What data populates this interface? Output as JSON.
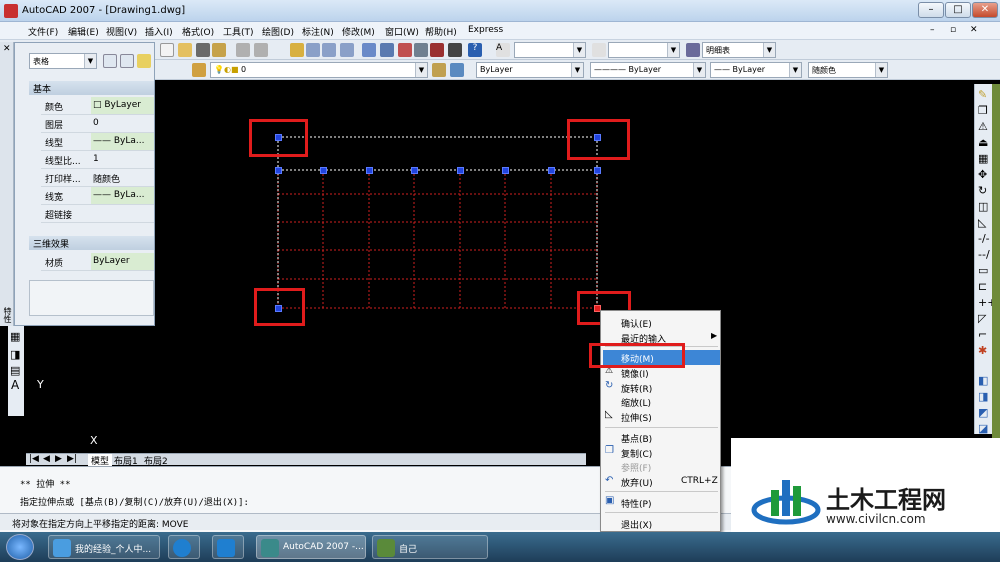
{
  "window": {
    "title": "AutoCAD 2007 - [Drawing1.dwg]",
    "min": "–",
    "max": "□",
    "close": "✕"
  },
  "menu": [
    "文件(F)",
    "编辑(E)",
    "视图(V)",
    "插入(I)",
    "格式(O)",
    "工具(T)",
    "绘图(D)",
    "标注(N)",
    "修改(M)",
    "窗口(W)",
    "帮助(H)",
    "Express"
  ],
  "toolbar1": {
    "textstyle": "明细表"
  },
  "toolbar2": {
    "layer": "0",
    "color": "ByLayer",
    "linetype": "ByLayer",
    "lineweight": "ByLayer",
    "plotstyle": "随颜色"
  },
  "props": {
    "object_type": "表格",
    "section_basic": "基本",
    "rows": [
      {
        "k": "颜色",
        "v": "□ ByLayer"
      },
      {
        "k": "图层",
        "v": "0"
      },
      {
        "k": "线型",
        "v": "—— ByLa..."
      },
      {
        "k": "线型比...",
        "v": "1"
      },
      {
        "k": "打印样...",
        "v": "随颜色"
      },
      {
        "k": "线宽",
        "v": "—— ByLa..."
      },
      {
        "k": "超链接",
        "v": ""
      }
    ],
    "section_3d": "三维效果",
    "material_k": "材质",
    "material_v": "ByLayer",
    "side_label": "特性"
  },
  "ucs": {
    "x": "X",
    "y": "Y"
  },
  "tabs": {
    "model": "模型",
    "layout1": "布局1",
    "layout2": "布局2"
  },
  "command": {
    "line1": "** 拉伸 **",
    "line2": "指定拉伸点或 [基点(B)/复制(C)/放弃(U)/退出(X)]:",
    "status": "将对象在指定方向上平移指定的距离:  MOVE"
  },
  "context_menu": {
    "enter": "确认(E)",
    "recent": "最近的输入",
    "move": "移动(M)",
    "mirror": "镜像(I)",
    "rotate": "旋转(R)",
    "scale": "缩放(L)",
    "stretch": "拉伸(S)",
    "basepoint": "基点(B)",
    "copy": "复制(C)",
    "reference": "参照(F)",
    "undo": "放弃(U)",
    "undo_shortcut": "CTRL+Z",
    "properties": "特性(P)",
    "exit": "退出(X)"
  },
  "taskbar": [
    {
      "label": "我的经验_个人中...",
      "color": "#4a9de0"
    },
    {
      "label": "",
      "color": "#1f7fd0"
    },
    {
      "label": "",
      "color": "#1f7fd0"
    },
    {
      "label": "AutoCAD 2007 -...",
      "color": "#3a8a8a"
    },
    {
      "label": "自己",
      "color": "#5a8a3a"
    }
  ],
  "watermark": {
    "name": "土木工程网",
    "url": "www.civilcn.com"
  },
  "colors": {
    "highlight": "#3d86d6",
    "annotation": "#e01c1c",
    "grip": "#2244dd"
  }
}
